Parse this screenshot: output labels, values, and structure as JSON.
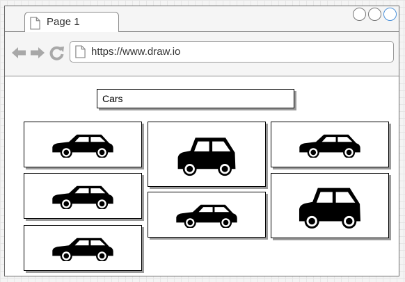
{
  "browser": {
    "tab": {
      "label": "Page 1",
      "icon": "document-icon"
    },
    "window_buttons": [
      "minimize-button",
      "maximize-button",
      "close-button"
    ],
    "nav": {
      "back_icon": "arrow-left-icon",
      "forward_icon": "arrow-right-icon",
      "reload_icon": "reload-icon"
    },
    "address_bar": {
      "url": "https://www.draw.io",
      "icon": "document-icon"
    }
  },
  "content": {
    "search": {
      "value": "Cars"
    },
    "results": [
      {
        "icon": "car-icon",
        "style": "sedan"
      },
      {
        "icon": "car-icon",
        "style": "hatchback"
      },
      {
        "icon": "car-icon",
        "style": "sedan"
      },
      {
        "icon": "car-icon",
        "style": "sedan"
      },
      {
        "icon": "car-icon",
        "style": "sedan"
      },
      {
        "icon": "car-icon",
        "style": "hatchback"
      },
      {
        "icon": "car-icon",
        "style": "sedan"
      }
    ]
  },
  "colors": {
    "border": "#000000",
    "shadow": "#9a9a9a",
    "chrome": "#f5f5f5",
    "icon_gray": "#a8a8a8",
    "accent": "#4a90d9"
  }
}
